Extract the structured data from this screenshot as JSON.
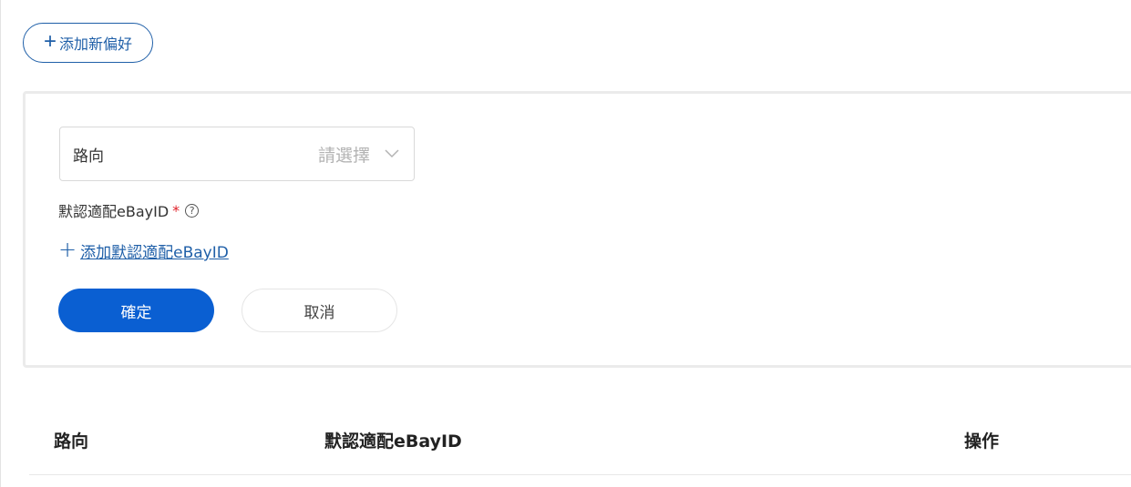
{
  "toolbar": {
    "add_preference_icon": "plus-icon",
    "add_preference_label": "添加新偏好"
  },
  "form": {
    "route_select": {
      "label": "路向",
      "placeholder": "請選擇",
      "icon": "chevron-down-icon"
    },
    "default_ebay_id": {
      "label": "默認適配eBayID",
      "required_mark": "*",
      "help_icon": "question-circle-icon",
      "help_glyph": "?"
    },
    "add_default_link": {
      "icon": "plus-icon",
      "label": "添加默認適配eBayID"
    },
    "confirm_label": "確定",
    "cancel_label": "取消"
  },
  "table": {
    "columns": [
      "路向",
      "默認適配eBayID",
      "操作"
    ]
  },
  "colors": {
    "primary": "#0a5fd2",
    "link": "#1f5fa8",
    "required": "#e0212a"
  }
}
